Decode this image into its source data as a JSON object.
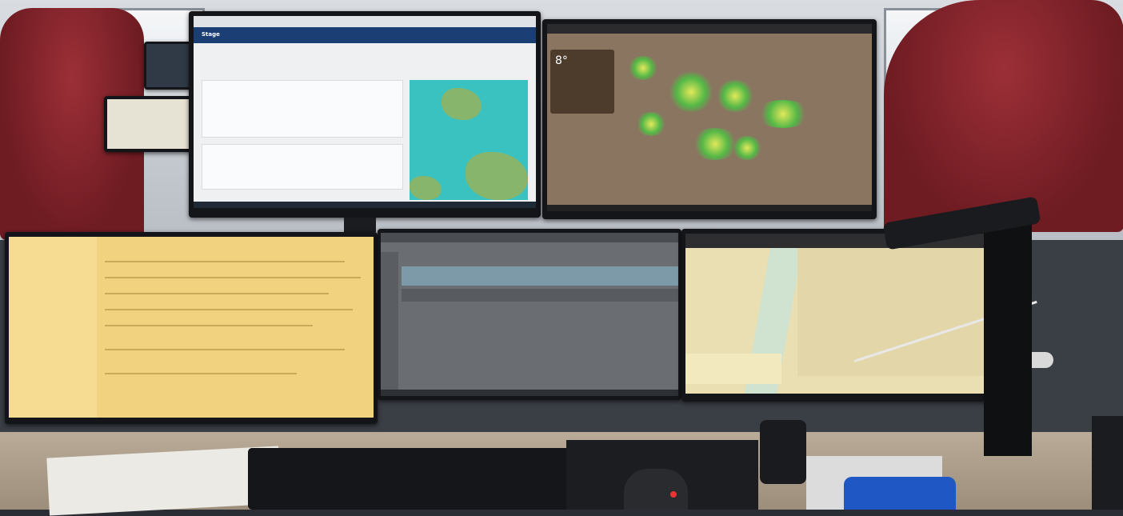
{
  "scene": "control-room-desk",
  "monitors": [
    {
      "id": "top-left",
      "app": "web-portal-with-map"
    },
    {
      "id": "top-right",
      "app": "weather-radar-map"
    },
    {
      "id": "bottom-left",
      "app": "document-list"
    },
    {
      "id": "bottom-center",
      "app": "data-table-app"
    },
    {
      "id": "bottom-right",
      "app": "nautical-chart"
    }
  ],
  "screen_text": {
    "top_left_title": "Stage",
    "top_right_temp": "8°"
  },
  "colors": {
    "brand_blue": "#1b3f75",
    "sea": "#39c2c0",
    "radar_green": "#54b847",
    "chart_paper": "#e9dfb2"
  }
}
